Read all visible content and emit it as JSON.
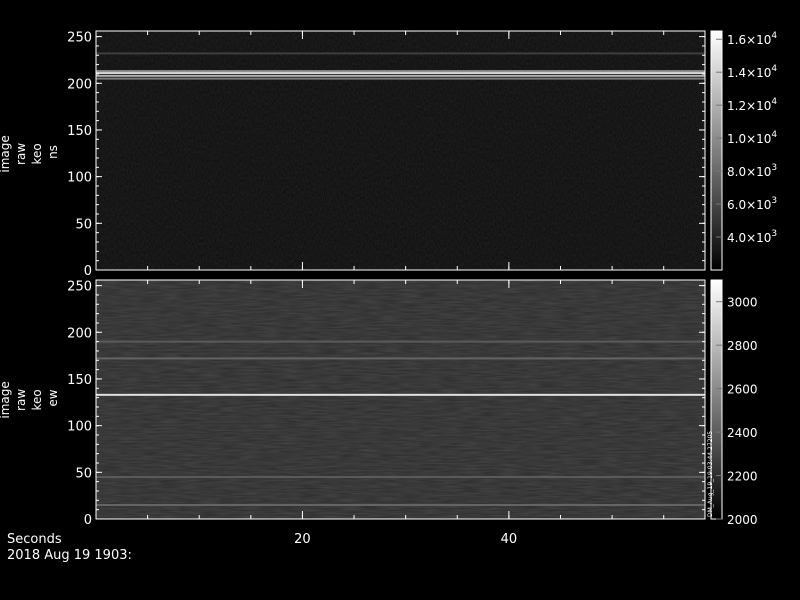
{
  "chart_data": [
    {
      "type": "heatmap",
      "panel": "top",
      "ylabel": [
        "image",
        "raw",
        "keo",
        "ns"
      ],
      "xlim": [
        0,
        59
      ],
      "ylim": [
        0,
        256
      ],
      "yticks": [
        0,
        50,
        100,
        150,
        200,
        250
      ],
      "xticks": [
        20,
        40
      ],
      "colorbar": {
        "range": [
          2000,
          16500
        ],
        "ticks": [
          {
            "value": 4000,
            "mantissa": "4.0",
            "exp": "3"
          },
          {
            "value": 6000,
            "mantissa": "6.0",
            "exp": "3"
          },
          {
            "value": 8000,
            "mantissa": "8.0",
            "exp": "3"
          },
          {
            "value": 10000,
            "mantissa": "1.0",
            "exp": "4"
          },
          {
            "value": 12000,
            "mantissa": "1.2",
            "exp": "4"
          },
          {
            "value": 14000,
            "mantissa": "1.4",
            "exp": "4"
          },
          {
            "value": 16000,
            "mantissa": "1.6",
            "exp": "4"
          }
        ]
      },
      "bands": [
        {
          "y": 205,
          "level": 0.45
        },
        {
          "y": 208,
          "level": 0.72
        },
        {
          "y": 211,
          "level": 0.9
        },
        {
          "y": 213,
          "level": 0.55
        },
        {
          "y": 232,
          "level": 0.12
        }
      ]
    },
    {
      "type": "heatmap",
      "panel": "bottom",
      "ylabel": [
        "image",
        "raw",
        "keo",
        "ew"
      ],
      "xlim": [
        0,
        59
      ],
      "ylim": [
        0,
        256
      ],
      "yticks": [
        0,
        50,
        100,
        150,
        200,
        250
      ],
      "xticks": [
        20,
        40
      ],
      "colorbar": {
        "range": [
          2000,
          3100
        ],
        "ticks": [
          {
            "value": 2000,
            "label": "2000"
          },
          {
            "value": 2200,
            "label": "2200"
          },
          {
            "value": 2400,
            "label": "2400"
          },
          {
            "value": 2600,
            "label": "2600"
          },
          {
            "value": 2800,
            "label": "2800"
          },
          {
            "value": 3000,
            "label": "3000"
          }
        ],
        "annotation": "DM_Aug_19_19:03:44.27205"
      },
      "bands": [
        {
          "y": 133,
          "level": 0.95
        },
        {
          "y": 172,
          "level": 0.3
        },
        {
          "y": 190,
          "level": 0.25
        },
        {
          "y": 15,
          "level": 0.3
        },
        {
          "y": 45,
          "level": 0.25
        }
      ]
    }
  ],
  "footer": {
    "axis_title": "Seconds",
    "date": "2018 Aug 19 1903:"
  }
}
